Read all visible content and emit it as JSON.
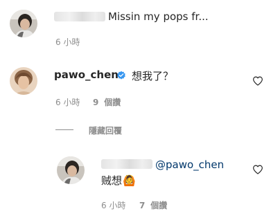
{
  "comments": [
    {
      "text": "Missin my pops fr...",
      "time": "6 小時"
    },
    {
      "username": "pawo_chen",
      "text": "想我了？",
      "time": "6 小時",
      "likes_count": "9",
      "likes_label": "個讚"
    }
  ],
  "hide_replies_label": "隱藏回覆",
  "reply": {
    "mention": "@pawo_chen",
    "text": "贼想",
    "emoji": "🙆",
    "time": "6 小時",
    "likes_count": "7",
    "likes_label": "個讚"
  },
  "colors": {
    "meta": "#8e8e8e",
    "mention": "#00376b",
    "verified": "#3897f0"
  },
  "icons": [
    "avatar",
    "verified-badge-icon",
    "heart-icon",
    "heart-icon"
  ]
}
